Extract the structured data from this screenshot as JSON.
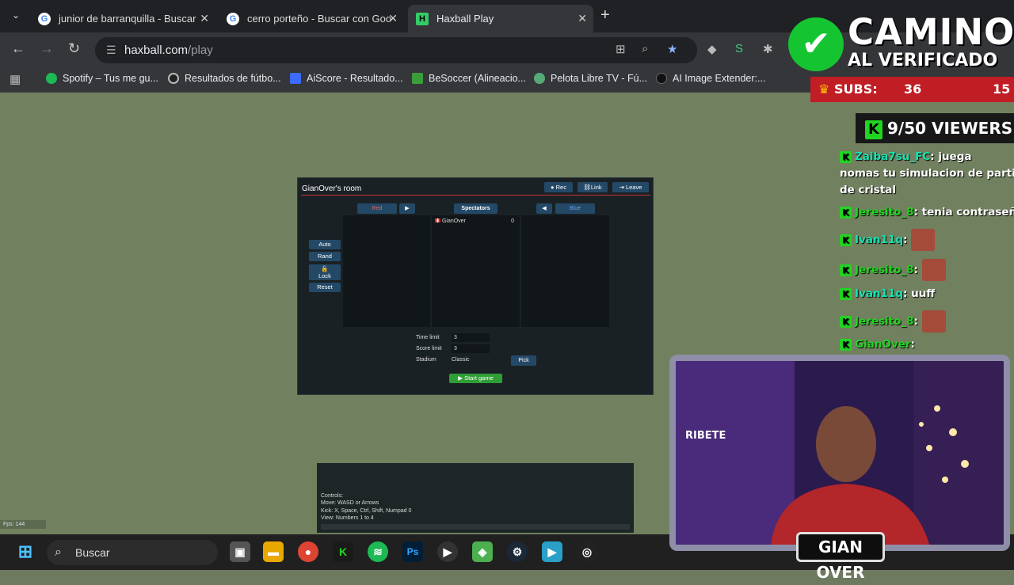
{
  "browser": {
    "tabs": [
      {
        "title": "junior de barranquilla - Buscar",
        "icon": "google-icon"
      },
      {
        "title": "cerro porteño - Buscar con Goo",
        "icon": "google-icon"
      },
      {
        "title": "Haxball Play",
        "icon": "haxball-icon",
        "active": true
      }
    ],
    "url_host": "haxball.com",
    "url_path": "/play",
    "bookmarks": [
      "Spotify – Tus me gu...",
      "Resultados de fútbo...",
      "AiScore - Resultado...",
      "BeSoccer (Alineacio...",
      "Pelota Libre TV - Fú...",
      "AI Image Extender:..."
    ]
  },
  "room": {
    "title": "GianOver's room",
    "buttons": {
      "rec": "Rec",
      "link": "Link",
      "leave": "Leave"
    },
    "teams": {
      "red": "Red",
      "spectators": "Spectators",
      "blue": "Blue",
      "move_right": "▶",
      "move_left": "◀"
    },
    "side_buttons": {
      "auto": "Auto",
      "rand": "Rand",
      "lock": "Lock",
      "reset": "Reset"
    },
    "spectators_list": [
      {
        "name": "GianOver",
        "score": "0"
      }
    ],
    "settings": {
      "time_limit_label": "Time limit",
      "time_limit": "3",
      "score_limit_label": "Score limit",
      "score_limit": "3",
      "stadium_label": "Stadium",
      "stadium": "Classic",
      "pick": "Pick"
    },
    "start": "Start game"
  },
  "console": {
    "lines": [
      "Controls:",
      "Move: WASD or Arrows",
      "Kick: X, Space, Ctrl, Shift, Numpad 0",
      "View: Numbers 1 to 4"
    ]
  },
  "fps": "Fps: 144",
  "taskbar": {
    "search": "Buscar"
  },
  "stream": {
    "camino": "CAMINO",
    "al_verificado": "AL VERIFICADO",
    "subs_label": "SUBS:",
    "subs_current": "36",
    "subs_goal": "15",
    "viewers": "9/50 VIEWERS",
    "chat": [
      {
        "user": "Zaiba7su_FC",
        "text": ": juega"
      },
      {
        "user": "",
        "text": "nomas tu simulacion de partidos"
      },
      {
        "user": "",
        "text": "de cristal"
      },
      {
        "user": "Jeresito_8",
        "text": ": tenia contraseña"
      },
      {
        "user": "Ivan11q",
        "text": ":"
      },
      {
        "user": "Jeresito_8",
        "text": ":"
      },
      {
        "user": "Ivan11q",
        "text": ": uuff"
      },
      {
        "user": "Jeresito_8",
        "text": ":"
      },
      {
        "user": "GianOver",
        "text": ":"
      }
    ],
    "cam_label": "GIAN OVER",
    "cam_sign": "RIBETE"
  }
}
